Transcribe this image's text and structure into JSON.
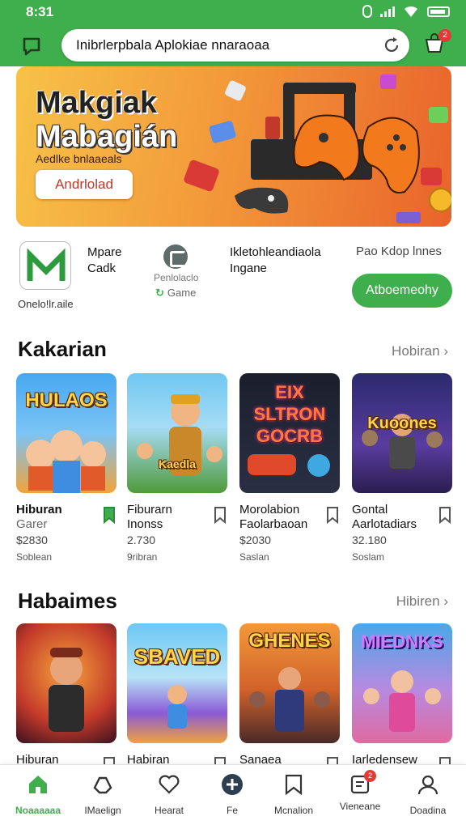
{
  "status": {
    "time": "8:31"
  },
  "search": {
    "text": "Inibrlerpbala Aplokiae nnaraoaa"
  },
  "cart": {
    "badge": "2"
  },
  "banner": {
    "title_line1": "Makgiak",
    "title_line2": "Mabagián",
    "subtitle": "Aedlke bnlaaeals",
    "button": "Andrlolad"
  },
  "app": {
    "logo_caption": "Onelo!lr.aile",
    "name_line1": "Mpare",
    "name_line2": "Cadk",
    "category_line1": "Penlolaclo",
    "category_line2": "Game",
    "desc_line1": "Ikletohleandiaola",
    "desc_line2": "Ingane",
    "hint": "Pao Kdop lnnes",
    "install_label": "Atboemeohy"
  },
  "section1": {
    "title": "Kakarian",
    "more": "Hobiran",
    "cards": [
      {
        "art_text": "HULAOS",
        "line1": "Hiburan",
        "line2": "Garer",
        "price": "$2830",
        "meta": "Soblean"
      },
      {
        "art_text": "Kaedla",
        "line1": "Fiburarn",
        "line2": "Inonss",
        "price": "2.730",
        "meta": "9ribran"
      },
      {
        "art_text": "EIX SLTRON GOCRB",
        "line1": "Morolabion",
        "line2": "Faolarbaoan",
        "price": "$2030",
        "meta": "Saslan"
      },
      {
        "art_text": "Kuoones Games",
        "line1": "Gontal",
        "line2": "Aarlotadiars",
        "price": "32.180",
        "meta": "Soslam"
      }
    ]
  },
  "section2": {
    "title": "Habaimes",
    "more": "Hibiren",
    "cards": [
      {
        "art_text": "",
        "line1": "Hiburan"
      },
      {
        "art_text": "SBAVED",
        "line1": "Habiran"
      },
      {
        "art_text": "GHENES",
        "line1": "Sanaea"
      },
      {
        "art_text": "MIEDNKS",
        "line1": "Iarledensew"
      }
    ]
  },
  "nav": {
    "items": [
      {
        "label": "Noaaaaaa",
        "icon": "home-icon"
      },
      {
        "label": "IMaelign",
        "icon": "controller-icon"
      },
      {
        "label": "Hearat",
        "icon": "heart-icon"
      },
      {
        "label": "Fe",
        "icon": "gamepad-icon"
      },
      {
        "label": "Mcnalion",
        "icon": "bookmark-icon"
      },
      {
        "label": "Vieneane",
        "icon": "notification-icon",
        "badge": "2"
      },
      {
        "label": "Doadina",
        "icon": "profile-icon"
      }
    ]
  },
  "colors": {
    "brand_green": "#3fae4c",
    "badge_red": "#e53935"
  }
}
